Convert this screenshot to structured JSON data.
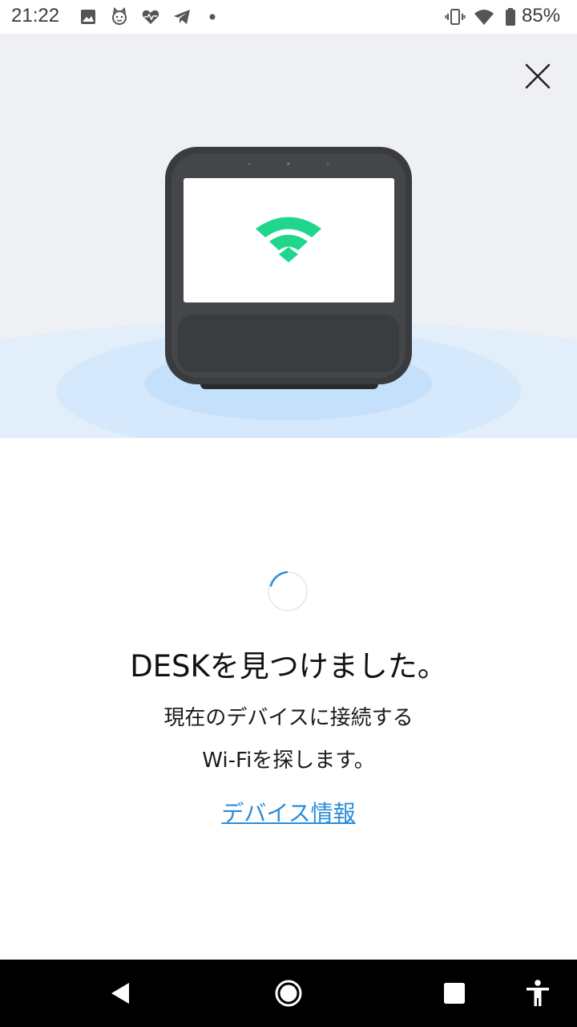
{
  "status_bar": {
    "time": "21:22",
    "battery": "85%",
    "notification_icons": [
      "image-icon",
      "cat-icon",
      "heart-pulse-icon",
      "telegram-icon",
      "dot-icon"
    ],
    "system_icons": [
      "vibrate-icon",
      "wifi-icon",
      "battery-icon"
    ]
  },
  "hero": {
    "close_icon": "close-icon",
    "device_screen_icon": "wifi-icon",
    "colors": {
      "background": "#eff0f4",
      "wifi": "#1fd68a",
      "device_body": "#3a3b3e",
      "ripple": "#cfe4fb"
    }
  },
  "main": {
    "headline": "DESKを見つけました。",
    "description_line1": "現在のデバイスに接続する",
    "description_line2": "Wi-Fiを探します。",
    "device_info_link": "デバイス情報",
    "link_color": "#2a8ddb"
  },
  "nav_bar": {
    "buttons": [
      "back-icon",
      "home-icon",
      "recents-icon",
      "accessibility-icon"
    ]
  }
}
